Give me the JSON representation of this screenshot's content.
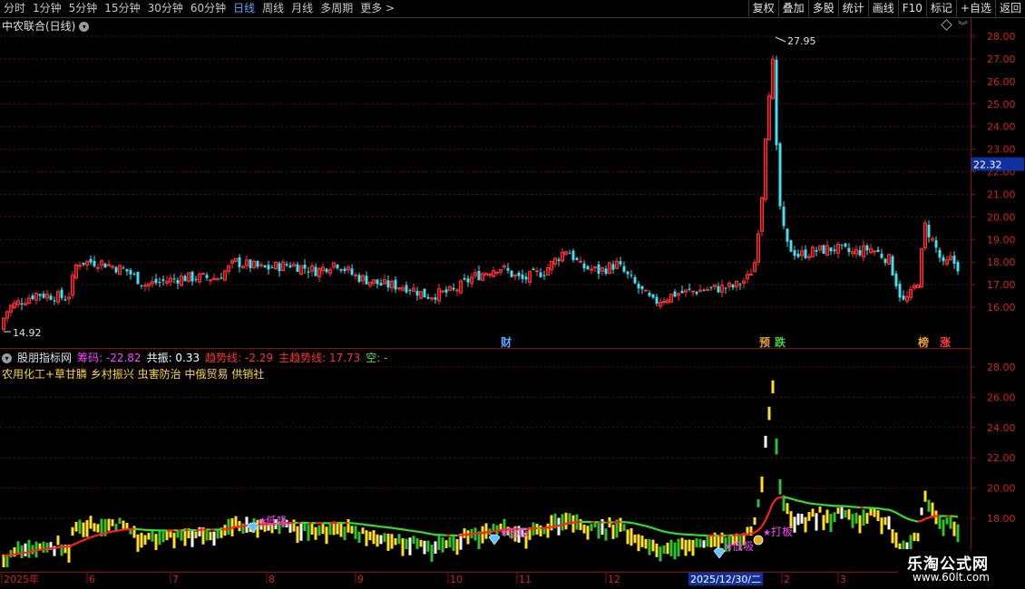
{
  "toolbar": {
    "periods": [
      {
        "label": "分时",
        "active": false
      },
      {
        "label": "1分钟",
        "active": false
      },
      {
        "label": "5分钟",
        "active": false
      },
      {
        "label": "15分钟",
        "active": false
      },
      {
        "label": "30分钟",
        "active": false
      },
      {
        "label": "60分钟",
        "active": false
      },
      {
        "label": "日线",
        "active": true
      },
      {
        "label": "周线",
        "active": false
      },
      {
        "label": "月线",
        "active": false
      },
      {
        "label": "多周期",
        "active": false
      },
      {
        "label": "更多 >",
        "active": false
      }
    ],
    "tools": [
      "复权",
      "叠加",
      "多股",
      "统计",
      "画线",
      "F10",
      "标记",
      "+自选",
      "返回"
    ]
  },
  "main_panel": {
    "title": "中农联合(日线)",
    "price_axis": [
      "28.00",
      "27.00",
      "26.00",
      "25.00",
      "24.00",
      "23.00",
      "22.00",
      "21.00",
      "20.00",
      "19.00",
      "18.00",
      "17.00",
      "16.00"
    ],
    "current_price_tag": "22.32",
    "high_label": "27.95",
    "low_label": "14.92",
    "event_marks": [
      {
        "text": "财",
        "color": "#5aa8ff"
      },
      {
        "text": "预",
        "color": "#e8a030"
      },
      {
        "text": "跌",
        "color": "#40d040"
      },
      {
        "text": "榜",
        "color": "#e8a030"
      },
      {
        "text": "涨",
        "color": "#ff4040"
      }
    ]
  },
  "indicator_panel": {
    "name": "股朋指标网",
    "values": [
      {
        "label": "筹码:",
        "value": "-22.82",
        "color": "#ff40ff"
      },
      {
        "label": "共振:",
        "value": "0.33",
        "color": "#ffffff"
      },
      {
        "label": "趋势线:",
        "value": "-2.29",
        "color": "#ff3030"
      },
      {
        "label": "主趋势线:",
        "value": "17.73",
        "color": "#ff3030"
      },
      {
        "label": "空:",
        "value": "-",
        "color": "#40e040"
      }
    ],
    "concepts": "农用化工+草甘膦 乡村振兴 虫害防治 中俄贸易 供销社",
    "axis": [
      "28.00",
      "26.00",
      "24.00",
      "22.00",
      "20.00",
      "18.00"
    ],
    "signals": {
      "low_buy": "低吸",
      "dragon": "打板"
    }
  },
  "time_axis": {
    "labels": [
      "2025年",
      "6",
      "7",
      "8",
      "9",
      "10",
      "11",
      "12",
      "2",
      "3"
    ],
    "cursor_date": "2025/12/30/二"
  },
  "watermark": {
    "title": "乐淘公式网",
    "url": "www.60lt.com"
  }
}
